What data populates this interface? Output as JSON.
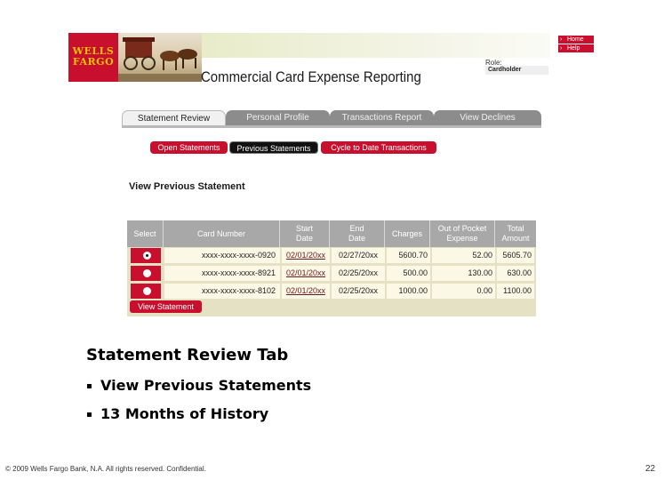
{
  "header": {
    "logo_line1": "WELLS",
    "logo_line2": "FARGO",
    "app_title": "Commercial Card Expense Reporting",
    "role_label": "Role:",
    "role_value": "Cardholder",
    "links": [
      "Home",
      "Help"
    ]
  },
  "tabs": [
    "Statement Review",
    "Personal Profile",
    "Transactions Report",
    "View Declines"
  ],
  "subtabs": [
    "Open Statements",
    "Previous Statements",
    "Cycle to Date Transactions"
  ],
  "section_title": "View Previous Statement",
  "table": {
    "columns": [
      "Select",
      "Card Number",
      "Start Date",
      "End Date",
      "Charges",
      "Out of Pocket Expense",
      "Total Amount"
    ],
    "rows": [
      {
        "card": "xxxx-xxxx-xxxx-0920",
        "start": "02/01/20xx",
        "end": "02/27/20xx",
        "charges": "5600.70",
        "oop": "52.00",
        "total": "5605.70",
        "selected": true
      },
      {
        "card": "xxxx-xxxx-xxxx-8921",
        "start": "02/01/20xx",
        "end": "02/25/20xx",
        "charges": "500.00",
        "oop": "130.00",
        "total": "630.00",
        "selected": false
      },
      {
        "card": "xxxx-xxxx-xxxx-8102",
        "start": "02/01/20xx",
        "end": "02/25/20xx",
        "charges": "1000.00",
        "oop": "0.00",
        "total": "1100.00",
        "selected": false
      }
    ],
    "view_button": "View Statement"
  },
  "caption": {
    "title": "Statement Review Tab",
    "bullets": [
      "View Previous Statements",
      "13 Months of History"
    ],
    "bullet_mark": "▪"
  },
  "footer": "© 2009 Wells Fargo Bank, N.A. All rights reserved. Confidential.",
  "page_number": "22",
  "colors": {
    "brand_red": "#c8102e",
    "logo_gold": "#f2c200",
    "table_bg": "#e4e1c4"
  }
}
